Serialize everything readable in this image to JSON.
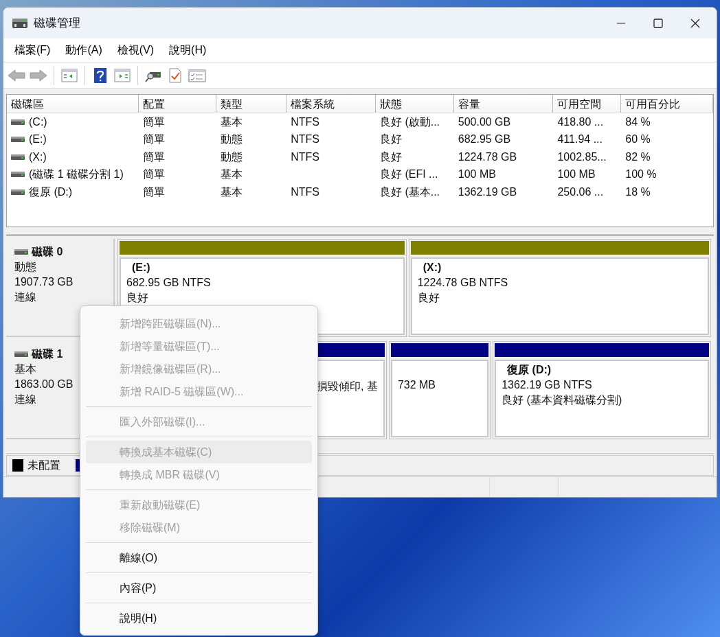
{
  "window": {
    "title": "磁碟管理"
  },
  "menu_bar": [
    "檔案(F)",
    "動作(A)",
    "檢視(V)",
    "說明(H)"
  ],
  "toolbar": [
    {
      "kind": "back",
      "disabled": true
    },
    {
      "kind": "forward",
      "disabled": true
    },
    {
      "kind": "sep"
    },
    {
      "kind": "tree"
    },
    {
      "kind": "sep"
    },
    {
      "kind": "help"
    },
    {
      "kind": "pane"
    },
    {
      "kind": "sep"
    },
    {
      "kind": "rescan"
    },
    {
      "kind": "check"
    },
    {
      "kind": "list"
    }
  ],
  "table": {
    "columns": [
      "磁碟區",
      "配置",
      "類型",
      "檔案系統",
      "狀態",
      "容量",
      "可用空間",
      "可用百分比"
    ],
    "rows": [
      [
        "(C:)",
        "簡單",
        "基本",
        "NTFS",
        "良好 (啟動...",
        "500.00 GB",
        "418.80 ...",
        "84 %"
      ],
      [
        "(E:)",
        "簡單",
        "動態",
        "NTFS",
        "良好",
        "682.95 GB",
        "411.94 ...",
        "60 %"
      ],
      [
        "(X:)",
        "簡單",
        "動態",
        "NTFS",
        "良好",
        "1224.78 GB",
        "1002.85...",
        "82 %"
      ],
      [
        "(磁碟 1 磁碟分割 1)",
        "簡單",
        "基本",
        "",
        "良好 (EFI ...",
        "100 MB",
        "100 MB",
        "100 %"
      ],
      [
        "復原 (D:)",
        "簡單",
        "基本",
        "NTFS",
        "良好 (基本...",
        "1362.19 GB",
        "250.06 ...",
        "18 %"
      ]
    ]
  },
  "disks": [
    {
      "name": "磁碟 0",
      "type": "動態",
      "size": "1907.73 GB",
      "status": "連線",
      "partitions": [
        {
          "kind": "volume",
          "color": "#808000",
          "label": "(E:)",
          "lines": [
            "682.95 GB NTFS",
            "良好"
          ]
        },
        {
          "kind": "volume",
          "color": "#808000",
          "label": "(X:)",
          "lines": [
            "1224.78 GB NTFS",
            "良好"
          ]
        }
      ]
    },
    {
      "name": "磁碟 1",
      "type": "基本",
      "size": "1863.00 GB",
      "status": "連線",
      "partitions": [
        {
          "kind": "clipped",
          "color": "#000080",
          "lines": [
            "損毀傾印, 基"
          ]
        },
        {
          "kind": "volume",
          "color": "#000080",
          "lines": [
            "732 MB"
          ]
        },
        {
          "kind": "volume",
          "color": "#000080",
          "label": "復原  (D:)",
          "lines": [
            "1362.19 GB NTFS",
            "良好 (基本資料磁碟分割)"
          ]
        }
      ]
    }
  ],
  "legend": [
    {
      "label": "未配置",
      "color": "#000000"
    },
    {
      "color": "#000080"
    }
  ],
  "context_menu": {
    "groups": [
      [
        {
          "label": "新增跨距磁碟區(N)...",
          "disabled": true,
          "selected": false
        },
        {
          "label": "新增等量磁碟區(T)...",
          "disabled": true,
          "selected": false
        },
        {
          "label": "新增鏡像磁碟區(R)...",
          "disabled": true,
          "selected": false
        },
        {
          "label": "新增 RAID-5 磁碟區(W)...",
          "disabled": true,
          "selected": false
        }
      ],
      [
        {
          "label": "匯入外部磁碟(I)...",
          "disabled": true,
          "selected": false
        }
      ],
      [
        {
          "label": "轉換成基本磁碟(C)",
          "disabled": true,
          "selected": true
        },
        {
          "label": "轉換成 MBR 磁碟(V)",
          "disabled": true,
          "selected": false
        }
      ],
      [
        {
          "label": "重新啟動磁碟(E)",
          "disabled": true,
          "selected": false
        },
        {
          "label": "移除磁碟(M)",
          "disabled": true,
          "selected": false
        }
      ],
      [
        {
          "label": "離線(O)",
          "disabled": false,
          "selected": false
        }
      ],
      [
        {
          "label": "內容(P)",
          "disabled": false,
          "selected": false
        }
      ],
      [
        {
          "label": "說明(H)",
          "disabled": false,
          "selected": false
        }
      ]
    ]
  }
}
